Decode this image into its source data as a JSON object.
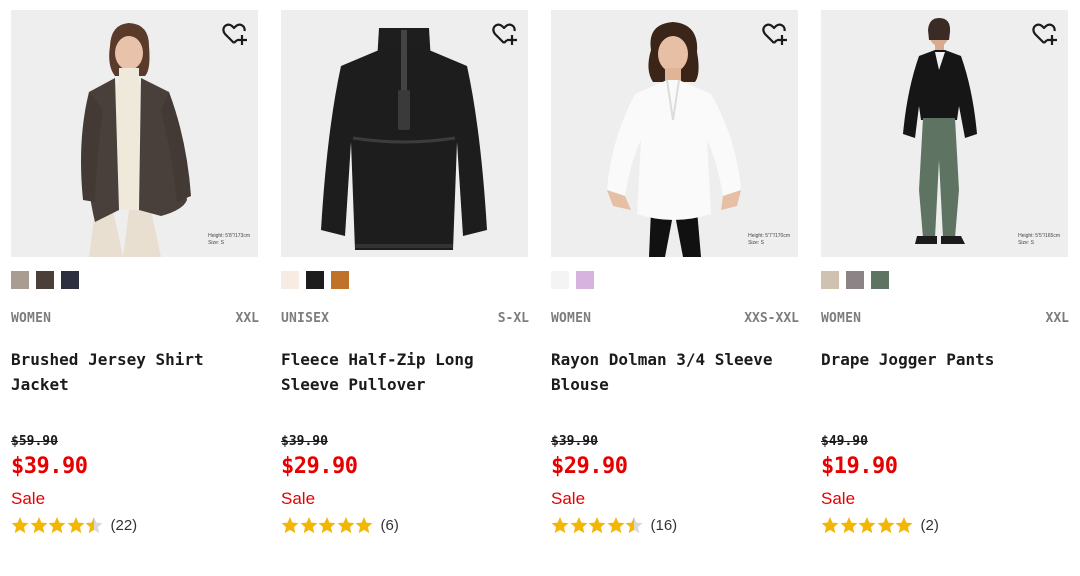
{
  "products": [
    {
      "gender": "WOMEN",
      "sizes": "XXL",
      "name": "Brushed Jersey Shirt Jacket",
      "was_price": "$59.90",
      "sale_price": "$39.90",
      "sale_label": "Sale",
      "rating": 4.5,
      "review_count": "(22)",
      "model_height": "Height: 5'8\"/173cm",
      "model_size": "Size: S",
      "swatches": [
        "#a99d92",
        "#4b3f39",
        "#2b2f3f"
      ]
    },
    {
      "gender": "UNISEX",
      "sizes": "S-XL",
      "name": "Fleece Half-Zip Long Sleeve Pullover",
      "was_price": "$39.90",
      "sale_price": "$29.90",
      "sale_label": "Sale",
      "rating": 5,
      "review_count": "(6)",
      "swatches": [
        "#f6ece3",
        "#1d1d1d",
        "#c0722b"
      ]
    },
    {
      "gender": "WOMEN",
      "sizes": "XXS-XXL",
      "name": "Rayon Dolman 3/4 Sleeve Blouse",
      "was_price": "$39.90",
      "sale_price": "$29.90",
      "sale_label": "Sale",
      "rating": 4.5,
      "review_count": "(16)",
      "model_height": "Height: 5'7\"/170cm",
      "model_size": "Size: S",
      "swatches": [
        "#f4f4f4",
        "#d7b3e0"
      ]
    },
    {
      "gender": "WOMEN",
      "sizes": "XXL",
      "name": "Drape Jogger Pants",
      "was_price": "$49.90",
      "sale_price": "$19.90",
      "sale_label": "Sale",
      "rating": 5,
      "review_count": "(2)",
      "model_height": "Height: 5'5\"/165cm",
      "model_size": "Size: S",
      "swatches": [
        "#cfc2b1",
        "#8c8386",
        "#5f7363"
      ]
    }
  ],
  "colors": {
    "sale": "#e60000",
    "star": "#f2b705",
    "star_empty": "#d8d8d8",
    "photo_bg": "#eeeeee"
  },
  "icons": {
    "favorite": "heart-plus-icon",
    "rating": "star-icon"
  }
}
